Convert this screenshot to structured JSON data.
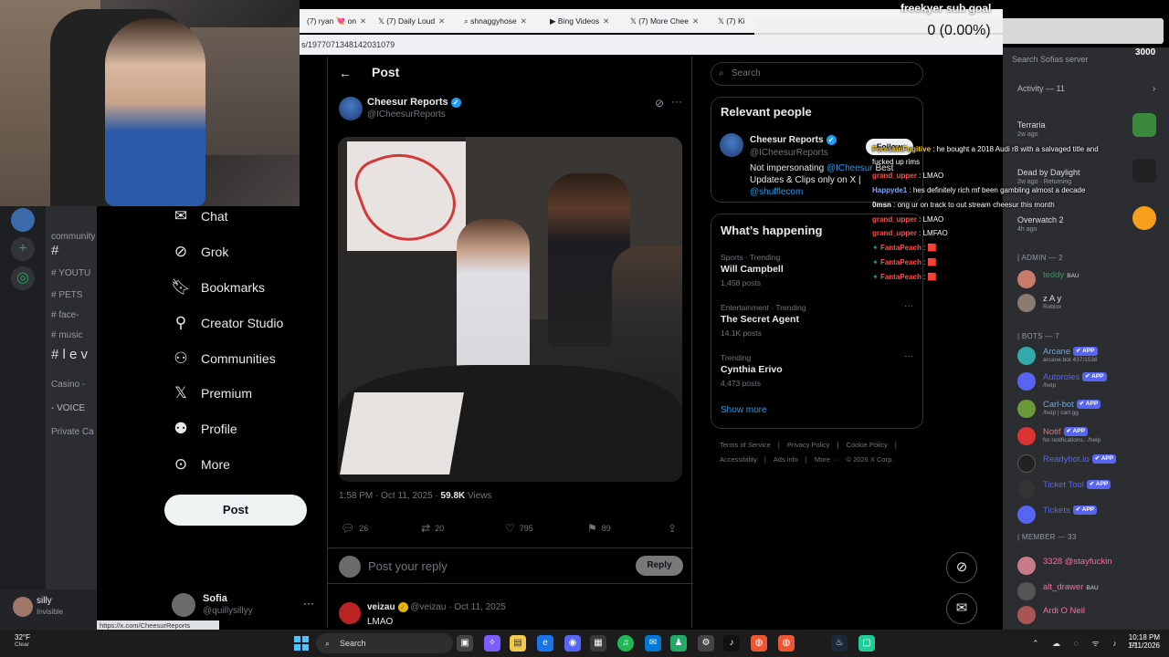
{
  "browser": {
    "tabs": [
      {
        "label": "(7) ryan 💘 on",
        "icon": "x-icon"
      },
      {
        "label": "(7) Daily Loud",
        "icon": "x-icon"
      },
      {
        "label": "shnaggyhose",
        "icon": "search-icon"
      },
      {
        "label": "Bing Videos",
        "icon": "bing-icon"
      },
      {
        "label": "(7) More Chee",
        "icon": "x-icon"
      },
      {
        "label": "(7) Ki",
        "icon": "x-icon"
      }
    ],
    "url": "s/1977071348142031079",
    "status_link": "https://x.com/CheesurReports"
  },
  "x_nav": {
    "items": [
      {
        "label": "Chat",
        "icon": "chat-icon"
      },
      {
        "label": "Grok",
        "icon": "grok-icon"
      },
      {
        "label": "Bookmarks",
        "icon": "bookmark-icon"
      },
      {
        "label": "Creator Studio",
        "icon": "creator-icon"
      },
      {
        "label": "Communities",
        "icon": "communities-icon"
      },
      {
        "label": "Premium",
        "icon": "x-logo-icon"
      },
      {
        "label": "Profile",
        "icon": "profile-icon"
      },
      {
        "label": "More",
        "icon": "more-icon"
      }
    ],
    "post_button": "Post",
    "account": {
      "name": "Sofia",
      "handle": "@quillysillyy"
    }
  },
  "post": {
    "header_title": "Post",
    "author_name": "Cheesur Reports",
    "author_handle": "@ICheesurReports",
    "timestamp": "1:58 PM · Oct 11, 2025 · ",
    "views_count": "59.8K",
    "views_label": " Views",
    "replies": "26",
    "reposts": "20",
    "likes": "795",
    "bookmarks": "89",
    "reply_placeholder": "Post your reply",
    "reply_button": "Reply",
    "first_reply": {
      "name": "veizau",
      "meta": " @veizau · Oct 11, 2025",
      "text": "LMAO"
    }
  },
  "sidebar": {
    "search_placeholder": "Search",
    "relevant_title": "Relevant people",
    "relevant": {
      "name": "Cheesur Reports",
      "handle": "@ICheesurReports",
      "bio_text": "Not impersonating ",
      "bio_link": "@ICheesur",
      "bio_text2": " Best Updates & Clips only on X | ",
      "bio_link2": "@shufflecom",
      "follow": "Follow"
    },
    "happening_title": "What’s happening",
    "trends": [
      {
        "category": "Sports · Trending",
        "name": "Will Campbell",
        "count": "1,458 posts"
      },
      {
        "category": "Entertainment · Trending",
        "name": "The Secret Agent",
        "count": "14.1K posts"
      },
      {
        "category": "Trending",
        "name": "Cynthia Erivo",
        "count": "4,473 posts"
      }
    ],
    "show_more": "Show more",
    "footer": [
      "Terms of Service",
      "|",
      "Privacy Policy",
      "|",
      "Cookie Policy",
      "|",
      "Accessibility",
      "|",
      "Ads info",
      "|",
      "More ···",
      "© 2026 X Corp."
    ]
  },
  "stream_overlay": {
    "subgoal_label": "freekyer sub goal",
    "subgoal_value": "0 (0.00%)",
    "subgoal_right": "3000"
  },
  "chat_overlay": [
    {
      "user": "ForeskinFugitive",
      "text": " : he bought a 2018 Audi r8 with a salvaged title and",
      "color": "#f5c518"
    },
    {
      "user": "",
      "text": "fucked up rims",
      "color": "#fff"
    },
    {
      "user": "grand_upper",
      "text": " : LMAO",
      "color": "#ff4d4d"
    },
    {
      "user": "Happyde1",
      "text": " : hes definitely rich mf been gambling almost a decade",
      "color": "#7aa7ff"
    },
    {
      "user": "0msn",
      "text": " : ong ur on track to out stream cheesur this month",
      "color": "#fff"
    },
    {
      "user": "grand_upper",
      "text": " : LMAO",
      "color": "#ff4d4d"
    },
    {
      "user": "grand_upper",
      "text": " : LMFAO",
      "color": "#ff4d4d"
    },
    {
      "user": "FantaPeach",
      "text": " : 🟥",
      "color": "#ff4d4d"
    },
    {
      "user": "FantaPeach",
      "text": " : 🟥",
      "color": "#ff4d4d"
    },
    {
      "user": "FantaPeach",
      "text": " : 🟥",
      "color": "#ff4d4d"
    }
  ],
  "discord_left": {
    "channels": [
      "community",
      "# ",
      "# YOUTU",
      "# PETS",
      "# face-",
      "# music",
      "# l e v",
      "Casino -",
      "- VOICE",
      "Private Ca"
    ],
    "user_name": "silly",
    "user_status": "Invisible"
  },
  "discord_right": {
    "search_placeholder": "Search Sofias server",
    "activity_label": "Activity — 11",
    "activities": [
      {
        "game": "Terraria",
        "sub": "2w ago"
      },
      {
        "game": "Dead by Daylight",
        "sub": "2w ago · Returning"
      },
      {
        "game": "Overwatch 2",
        "sub": "4h ago"
      }
    ],
    "admin_header": "| ADMIN — 2",
    "admins": [
      {
        "name": "teddy",
        "badge": "BAU",
        "sub": "",
        "color": "#23a55a"
      },
      {
        "name": "z A y",
        "badge": "",
        "sub": "Roblox",
        "color": "#dbdee1"
      }
    ],
    "bots_header": "| BOTS — 7",
    "bots": [
      {
        "name": "Arcane",
        "sub": "arcane.bot 437/1536",
        "color": "#5dadec"
      },
      {
        "name": "Autoroles",
        "sub": "/help",
        "color": "#5865f2"
      },
      {
        "name": "Carl-bot",
        "sub": "/help | carl.gg",
        "color": "#5dadec"
      },
      {
        "name": "Notif",
        "sub": "for notifications.. /help",
        "color": "#ff6b6b"
      },
      {
        "name": "Readybot.io",
        "sub": "",
        "color": "#5865f2"
      },
      {
        "name": "Ticket Tool",
        "sub": "",
        "color": "#5865f2"
      },
      {
        "name": "Tickets",
        "sub": "",
        "color": "#5865f2"
      }
    ],
    "app_badge": "✔ APP",
    "member_header": "| MEMBER — 33",
    "members": [
      {
        "name": "3328 @stayfuckin",
        "badge": "",
        "color": "#ff6b9e"
      },
      {
        "name": "alt_drawer",
        "badge": "BAU",
        "color": "#ff6b9e"
      },
      {
        "name": "Ardi O Neil",
        "badge": "",
        "color": "#ff6b9e"
      }
    ]
  },
  "taskbar": {
    "weather_temp": "32°F",
    "weather_desc": "Clear",
    "search_label": "Search",
    "time": "10:18 PM",
    "date": "1/11/2026"
  }
}
